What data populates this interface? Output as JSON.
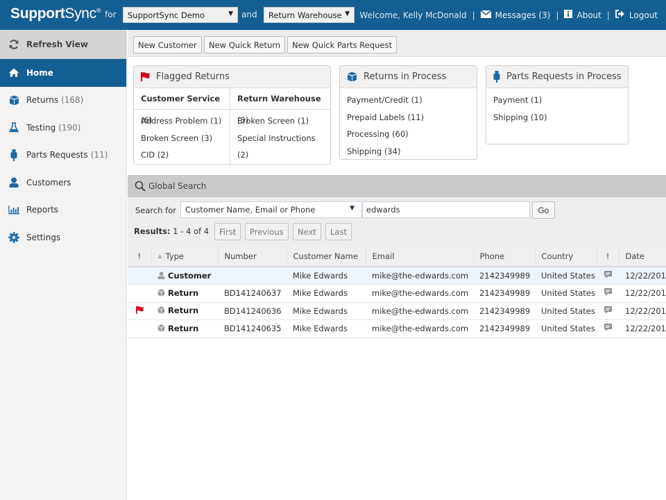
{
  "header": {
    "brand_bold": "Support",
    "brand_regular": "Sync",
    "brand_reg": "®",
    "for_label": "for",
    "company_select": "SupportSync Demo",
    "and_label": "and",
    "location_select": "Return Warehouse",
    "welcome": "Welcome, Kelly McDonald",
    "messages": "Messages (3)",
    "about": "About",
    "logout": "Logout",
    "separator": "|"
  },
  "sidebar": {
    "refresh": "Refresh View",
    "items": [
      {
        "label": "Home",
        "count": "",
        "icon": "home-icon",
        "active": true
      },
      {
        "label": "Returns",
        "count": "(168)",
        "icon": "box-icon"
      },
      {
        "label": "Testing",
        "count": "(190)",
        "icon": "flask-icon"
      },
      {
        "label": "Parts Requests",
        "count": "(11)",
        "icon": "usb-plug-icon"
      },
      {
        "label": "Customers",
        "count": "",
        "icon": "user-icon"
      },
      {
        "label": "Reports",
        "count": "",
        "icon": "bar-chart-icon"
      },
      {
        "label": "Settings",
        "count": "",
        "icon": "gear-icon"
      }
    ]
  },
  "toolbar": {
    "new_customer": "New Customer",
    "new_quick_return": "New Quick Return",
    "new_quick_parts_request": "New Quick Parts Request"
  },
  "flagged_returns": {
    "title": "Flagged Returns",
    "columns": [
      {
        "name": "Customer Service",
        "count": "(6)",
        "items": [
          "Address Problem (1)",
          "Broken Screen (3)",
          "CID (2)"
        ]
      },
      {
        "name": "Return Warehouse",
        "count": "(3)",
        "items": [
          "Broken Screen (1)",
          "Special Instructions (2)"
        ]
      }
    ]
  },
  "returns_in_process": {
    "title": "Returns in Process",
    "items": [
      "Payment/Credit (1)",
      "Prepaid Labels (11)",
      "Processing (60)",
      "Shipping (34)"
    ]
  },
  "parts_in_process": {
    "title": "Parts Requests in Process",
    "items": [
      "Payment (1)",
      "Shipping (10)"
    ]
  },
  "global_search": {
    "title": "Global Search",
    "search_for_label": "Search for",
    "search_type": "Customer Name, Email or Phone",
    "query": "edwards",
    "go": "Go",
    "results_label": "Results:",
    "results_range": "1 - 4 of 4",
    "pager": {
      "first": "First",
      "previous": "Previous",
      "next": "Next",
      "last": "Last"
    }
  },
  "table": {
    "headers": {
      "flag": "!",
      "type": "Type",
      "number": "Number",
      "customer_name": "Customer Name",
      "email": "Email",
      "phone": "Phone",
      "country": "Country",
      "note": "!",
      "date": "Date"
    },
    "rows": [
      {
        "flagged": false,
        "type": "Customer",
        "type_icon": "user-icon",
        "number": "",
        "customer_name": "Mike Edwards",
        "email": "mike@the-edwards.com",
        "phone": "2142349989",
        "country": "United States",
        "note": true,
        "date": "12/22/201",
        "selected": true
      },
      {
        "flagged": false,
        "type": "Return",
        "type_icon": "box-icon",
        "number": "BD141240637",
        "customer_name": "Mike Edwards",
        "email": "mike@the-edwards.com",
        "phone": "2142349989",
        "country": "United States",
        "note": true,
        "date": "12/22/201"
      },
      {
        "flagged": true,
        "type": "Return",
        "type_icon": "box-icon",
        "number": "BD141240636",
        "customer_name": "Mike Edwards",
        "email": "mike@the-edwards.com",
        "phone": "2142349989",
        "country": "United States",
        "note": true,
        "date": "12/22/201"
      },
      {
        "flagged": false,
        "type": "Return",
        "type_icon": "box-icon",
        "number": "BD141240635",
        "customer_name": "Mike Edwards",
        "email": "mike@the-edwards.com",
        "phone": "2142349989",
        "country": "United States",
        "note": true,
        "date": "12/22/201"
      }
    ]
  },
  "colors": {
    "brand": "#135e93",
    "flag": "#d0021b",
    "icon": "#1f6aa5"
  }
}
